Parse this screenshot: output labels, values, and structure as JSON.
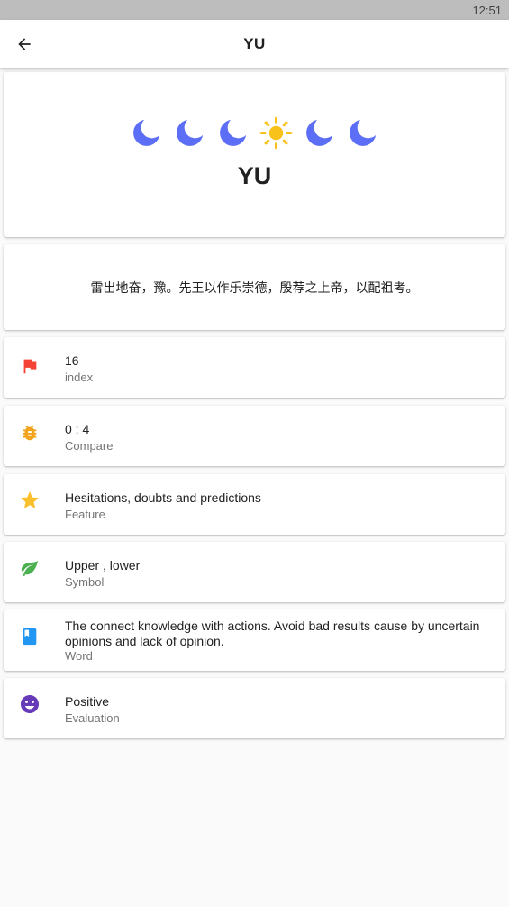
{
  "status_bar": {
    "time": "12:51"
  },
  "app_bar": {
    "title": "YU",
    "back_icon": "arrow-back-icon"
  },
  "hexagram": {
    "symbols": [
      "moon",
      "moon",
      "moon",
      "sun",
      "moon",
      "moon"
    ],
    "name": "YU",
    "moon_color": "#5b6ef5",
    "sun_color": "#f9c21b"
  },
  "quote": "雷出地奋，豫。先王以作乐崇德，殷荐之上帝，以配祖考。",
  "info": [
    {
      "icon": "flag-icon",
      "color": "#f44336",
      "value": "16",
      "label": "index"
    },
    {
      "icon": "bug-icon",
      "color": "#f3a31b",
      "value": "0 : 4",
      "label": "Compare"
    },
    {
      "icon": "star-icon",
      "color": "#fbc02d",
      "value": "Hesitations, doubts and predictions",
      "label": "Feature"
    },
    {
      "icon": "leaf-icon",
      "color": "#4caf50",
      "value": "Upper , lower",
      "label": "Symbol"
    },
    {
      "icon": "book-icon",
      "color": "#2196f3",
      "value": "The connect knowledge with actions. Avoid bad results cause by uncertain opinions and lack of opinion.",
      "label": "Word"
    },
    {
      "icon": "smiley-icon",
      "color": "#673ab7",
      "value": "Positive",
      "label": "Evaluation"
    }
  ]
}
